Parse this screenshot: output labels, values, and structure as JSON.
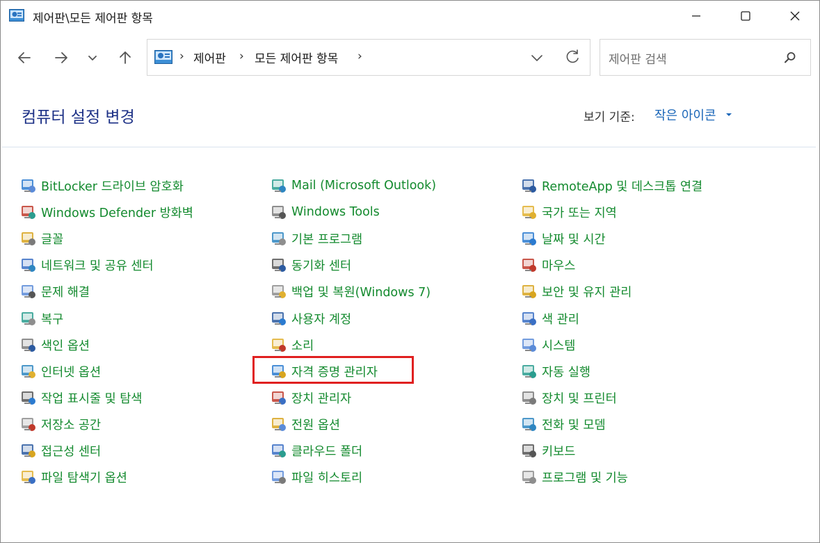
{
  "window": {
    "title": "제어판\\모든 제어판 항목",
    "minimize_icon": "minimize-icon",
    "maximize_icon": "maximize-icon",
    "close_icon": "close-icon"
  },
  "nav": {
    "breadcrumb": [
      "제어판",
      "모든 제어판 항목"
    ],
    "separator": "›",
    "search_placeholder": "제어판 검색"
  },
  "header": {
    "title": "컴퓨터 설정 변경",
    "view_by_label": "보기 기준:",
    "view_by_value": "작은 아이콘"
  },
  "columns": [
    [
      {
        "label": "BitLocker 드라이브 암호화",
        "icon": "bitlocker-key-icon"
      },
      {
        "label": "Windows Defender 방화벽",
        "icon": "firewall-brick-icon"
      },
      {
        "label": "글꼴",
        "icon": "font-folder-icon"
      },
      {
        "label": "네트워크 및 공유 센터",
        "icon": "network-icon"
      },
      {
        "label": "문제 해결",
        "icon": "troubleshoot-icon"
      },
      {
        "label": "복구",
        "icon": "recovery-icon"
      },
      {
        "label": "색인 옵션",
        "icon": "indexing-icon"
      },
      {
        "label": "인터넷 옵션",
        "icon": "internet-globe-icon"
      },
      {
        "label": "작업 표시줄 및 탐색",
        "icon": "taskbar-icon"
      },
      {
        "label": "저장소 공간",
        "icon": "storage-icon"
      },
      {
        "label": "접근성 센터",
        "icon": "accessibility-icon"
      },
      {
        "label": "파일 탐색기 옵션",
        "icon": "folder-options-icon"
      }
    ],
    [
      {
        "label": "Mail (Microsoft Outlook)",
        "icon": "mail-icon"
      },
      {
        "label": "Windows Tools",
        "icon": "tools-gear-icon"
      },
      {
        "label": "기본 프로그램",
        "icon": "default-programs-icon"
      },
      {
        "label": "동기화 센터",
        "icon": "sync-icon"
      },
      {
        "label": "백업 및 복원(Windows 7)",
        "icon": "backup-icon"
      },
      {
        "label": "사용자 계정",
        "icon": "user-accounts-icon"
      },
      {
        "label": "소리",
        "icon": "speaker-icon"
      },
      {
        "label": "자격 증명 관리자",
        "icon": "credential-vault-icon"
      },
      {
        "label": "장치 관리자",
        "icon": "device-manager-icon"
      },
      {
        "label": "전원 옵션",
        "icon": "power-icon"
      },
      {
        "label": "클라우드 폴더",
        "icon": "cloud-folder-icon"
      },
      {
        "label": "파일 히스토리",
        "icon": "file-history-icon"
      }
    ],
    [
      {
        "label": "RemoteApp 및 데스크톱 연결",
        "icon": "remoteapp-icon"
      },
      {
        "label": "국가 또는 지역",
        "icon": "region-globe-icon"
      },
      {
        "label": "날짜 및 시간",
        "icon": "date-time-icon"
      },
      {
        "label": "마우스",
        "icon": "mouse-icon"
      },
      {
        "label": "보안 및 유지 관리",
        "icon": "security-flag-icon"
      },
      {
        "label": "색 관리",
        "icon": "color-management-icon"
      },
      {
        "label": "시스템",
        "icon": "system-monitor-icon"
      },
      {
        "label": "자동 실행",
        "icon": "autoplay-icon"
      },
      {
        "label": "장치 및 프린터",
        "icon": "printer-icon"
      },
      {
        "label": "전화 및 모뎀",
        "icon": "phone-modem-icon"
      },
      {
        "label": "키보드",
        "icon": "keyboard-icon"
      },
      {
        "label": "프로그램 및 기능",
        "icon": "programs-features-icon"
      }
    ]
  ],
  "colors": {
    "link_green": "#138a2e",
    "title_blue": "#1e3287",
    "view_blue": "#1a66b8",
    "highlight_red": "#e02020"
  }
}
